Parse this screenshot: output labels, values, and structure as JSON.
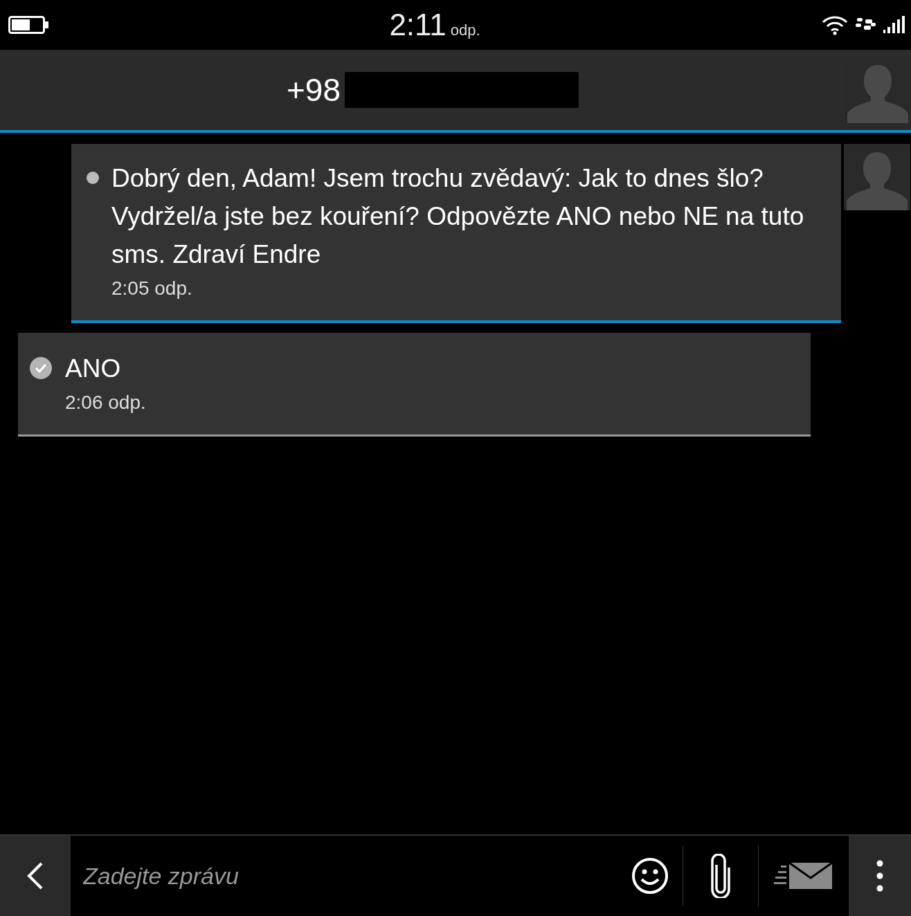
{
  "status_bar": {
    "time": "2:11",
    "period": "odp."
  },
  "header": {
    "contact": "+98"
  },
  "messages": [
    {
      "kind": "incoming",
      "text": "Dobrý den, Adam! Jsem trochu zvědavý: Jak to dnes šlo? Vydržel/a jste bez kouření? Odpovězte ANO nebo NE na tuto sms. Zdraví Endre",
      "time": "2:05 odp.",
      "unread": true
    },
    {
      "kind": "outgoing",
      "text": "ANO",
      "time": "2:06 odp.",
      "delivered": true
    }
  ],
  "composer": {
    "placeholder": "Zadejte zprávu"
  }
}
